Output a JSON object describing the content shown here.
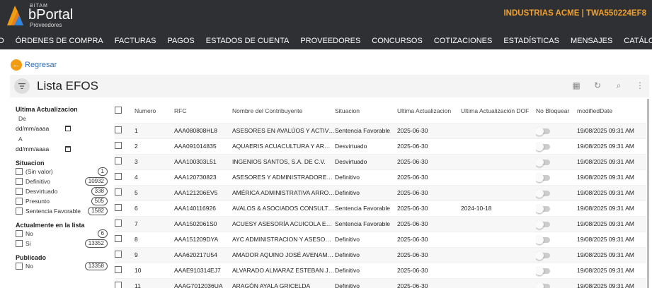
{
  "header": {
    "bitam": "BITAM",
    "brand": "bPortal",
    "brand_sub": "Proveedores",
    "company": "INDUSTRIAS ACME | TWA550224EF8"
  },
  "nav": [
    "INICIO",
    "ÓRDENES DE COMPRA",
    "FACTURAS",
    "PAGOS",
    "ESTADOS DE CUENTA",
    "PROVEEDORES",
    "CONCURSOS",
    "COTIZACIONES",
    "ESTADÍSTICAS",
    "MENSAJES",
    "CATÁLOGOS"
  ],
  "back_label": "Regresar",
  "page_title": "Lista EFOS",
  "filters": {
    "ultima_title": "Ultima Actualizacion",
    "de_label": "De",
    "a_label": "A",
    "date_placeholder": "dd/mm/aaaa",
    "situacion_title": "Situacion",
    "situacion": [
      {
        "label": "(Sin valor)",
        "count": "1"
      },
      {
        "label": "Definitivo",
        "count": "10932"
      },
      {
        "label": "Desvirtuado",
        "count": "338"
      },
      {
        "label": "Presunto",
        "count": "505"
      },
      {
        "label": "Sentencia Favorable",
        "count": "1582"
      }
    ],
    "actualmente_title": "Actualmente en la lista",
    "actualmente": [
      {
        "label": "No",
        "count": "6"
      },
      {
        "label": "Si",
        "count": "13352"
      }
    ],
    "publicado_title": "Publicado",
    "publicado": [
      {
        "label": "No",
        "count": "13358"
      }
    ]
  },
  "table": {
    "headers": [
      "Numero",
      "RFC",
      "Nombre del Contribuyente",
      "Situacion",
      "Ultima Actualizacion",
      "Ultima Actualización DOF",
      "No Bloquear",
      "modifiedDate"
    ],
    "rows": [
      [
        "1",
        "AAA080808HL8",
        "ASESORES EN AVALÚOS Y ACTIVOS, S.A. DE C.V.",
        "Sentencia Favorable",
        "2025-06-30",
        "",
        "19/08/2025 09:31 AM"
      ],
      [
        "2",
        "AAA091014835",
        "AQUAERIS ACUACULTURA Y ARQUITECTURA",
        "Desvirtuado",
        "2025-06-30",
        "",
        "19/08/2025 09:31 AM"
      ],
      [
        "3",
        "AAA100303L51",
        "INGENIOS SANTOS, S.A. DE C.V.",
        "Desvirtuado",
        "2025-06-30",
        "",
        "19/08/2025 09:31 AM"
      ],
      [
        "4",
        "AAA120730823",
        "ASESORES Y ADMINISTRADORES AGRICOLAS",
        "Definitivo",
        "2025-06-30",
        "",
        "19/08/2025 09:31 AM"
      ],
      [
        "5",
        "AAA121206EV5",
        "AMÉRICA ADMINISTRATIVA ARROLLO",
        "Definitivo",
        "2025-06-30",
        "",
        "19/08/2025 09:31 AM"
      ],
      [
        "6",
        "AAA140116926",
        "AVALOS & ASOCIADOS CONSULTORES",
        "Sentencia Favorable",
        "2025-06-30",
        "2024-10-18",
        "19/08/2025 09:31 AM"
      ],
      [
        "7",
        "AAA1502061S0",
        "ACUESY ASESORÍA ACUICOLA ESPECIALIZADA",
        "Sentencia Favorable",
        "2025-06-30",
        "",
        "19/08/2025 09:31 AM"
      ],
      [
        "8",
        "AAA151209DYA",
        "AYC ADMINISTRACION Y ASESORIA",
        "Definitivo",
        "2025-06-30",
        "",
        "19/08/2025 09:31 AM"
      ],
      [
        "9",
        "AAA620217U54",
        "AMADOR AQUINO JOSÉ AVENAMAR",
        "Definitivo",
        "2025-06-30",
        "",
        "19/08/2025 09:31 AM"
      ],
      [
        "10",
        "AAAE910314EJ7",
        "ALVARADO ALMARAZ ESTEBAN JAVIER",
        "Definitivo",
        "2025-06-30",
        "",
        "19/08/2025 09:31 AM"
      ],
      [
        "11",
        "AAAG7012036UA",
        "ARAGÓN AYALA GRICELDA",
        "Definitivo",
        "2025-06-30",
        "",
        "19/08/2025 09:31 AM"
      ]
    ]
  },
  "colors": {
    "header_bg": "#2f3033",
    "accent": "#f0a030",
    "link": "#2a6ebb"
  }
}
